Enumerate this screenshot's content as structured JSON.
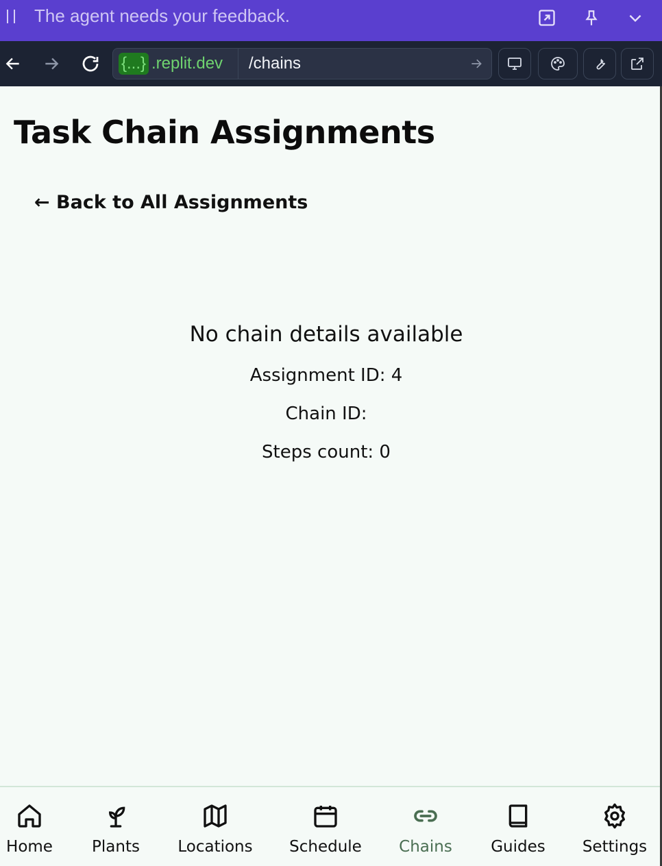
{
  "agent_banner": {
    "message": "The agent needs your feedback."
  },
  "browser": {
    "domain_badge": "{...}",
    "domain_suffix": ".replit.dev",
    "path": "/chains"
  },
  "page": {
    "title": "Task Chain Assignments",
    "back_link": "← Back to All Assignments",
    "empty_message": "No chain details available",
    "assignment_id": "Assignment ID: 4",
    "chain_id": "Chain ID:",
    "steps_count": "Steps count: 0"
  },
  "bottom_nav": {
    "active": "Chains",
    "accent": "#4a6e52",
    "items": [
      {
        "label": "Home",
        "icon": "home-icon"
      },
      {
        "label": "Plants",
        "icon": "sprout-icon"
      },
      {
        "label": "Locations",
        "icon": "map-icon"
      },
      {
        "label": "Schedule",
        "icon": "calendar-icon"
      },
      {
        "label": "Chains",
        "icon": "link-icon"
      },
      {
        "label": "Guides",
        "icon": "book-icon"
      },
      {
        "label": "Settings",
        "icon": "gear-icon"
      }
    ]
  }
}
